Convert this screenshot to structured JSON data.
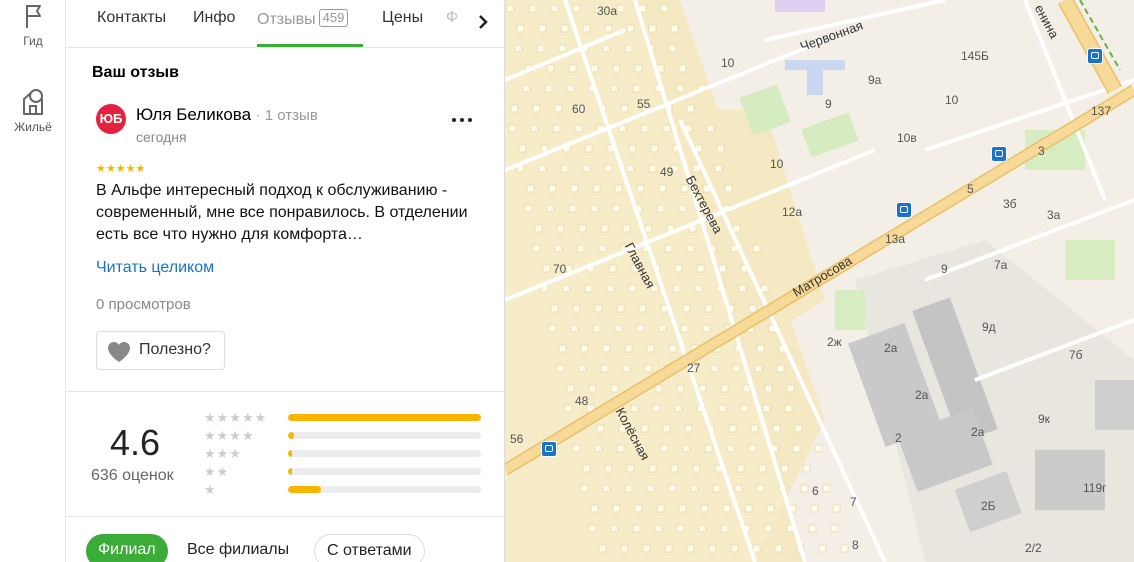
{
  "rail": {
    "items": [
      {
        "label": "Гид",
        "icon": "flag-icon"
      },
      {
        "label": "Жильё",
        "icon": "house-icon"
      }
    ]
  },
  "tabs": {
    "items": [
      {
        "label": "Контакты"
      },
      {
        "label": "Инфо"
      },
      {
        "label": "Отзывы",
        "count": "459"
      },
      {
        "label": "Цены"
      },
      {
        "label": "Ф"
      }
    ],
    "active": "Отзывы"
  },
  "my_review": {
    "title": "Ваш отзыв",
    "avatar_initials": "ЮБ",
    "author": "Юля Беликова",
    "author_reviews": "1 отзыв",
    "date": "сегодня",
    "stars": 5,
    "text": "В Альфе интересный подход к обслуживанию - современный, мне все понравилось. В отделении есть все что нужно для комфорта…",
    "read_more": "Читать целиком",
    "views": "0 просмотров",
    "useful_label": "Полезно?"
  },
  "rating": {
    "value": "4.6",
    "count_label": "636 оценок",
    "distribution": [
      {
        "stars": 5,
        "share": 1.0
      },
      {
        "stars": 4,
        "share": 0.03
      },
      {
        "stars": 3,
        "share": 0.02
      },
      {
        "stars": 2,
        "share": 0.02
      },
      {
        "stars": 1,
        "share": 0.17
      }
    ]
  },
  "filters": {
    "items": [
      "Филиал",
      "Все филиалы",
      "С ответами"
    ],
    "active": "Филиал"
  },
  "map": {
    "streets": [
      "Червонная",
      "Бехтерева",
      "Матросова",
      "Главная",
      "Колёсная",
      "енина"
    ],
    "house_numbers": [
      "30а",
      "10",
      "145Б",
      "9а",
      "60",
      "55",
      "9",
      "10",
      "137",
      "10в",
      "10",
      "3",
      "49",
      "5",
      "3б",
      "12а",
      "3а",
      "13а",
      "70",
      "9",
      "7а",
      "9д",
      "2ж",
      "2а",
      "7б",
      "27",
      "48",
      "2а",
      "9к",
      "56",
      "2а",
      "2",
      "119г",
      "6",
      "7",
      "2Б",
      "8",
      "2/2"
    ]
  },
  "colors": {
    "accent_green": "#3bac37",
    "link_blue": "#1a73c8",
    "star_yellow": "#f7b500",
    "avatar_red": "#e3223f",
    "road_orange": "#f4c56c"
  }
}
